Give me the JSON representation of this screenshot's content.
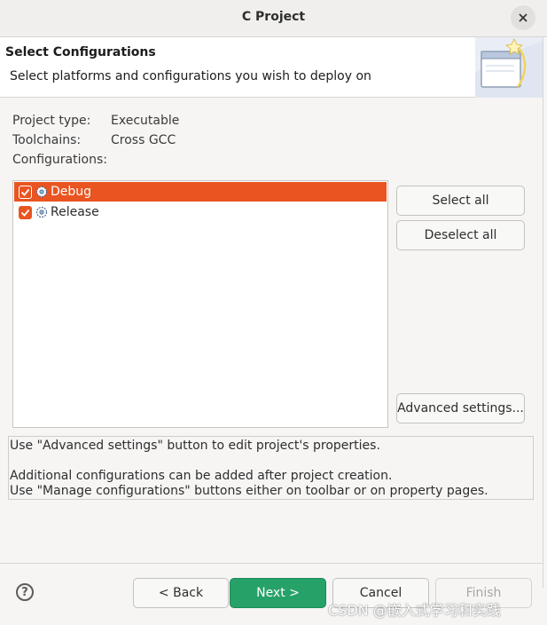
{
  "window": {
    "title": "C Project",
    "close_icon": "close-icon"
  },
  "header": {
    "title": "Select Configurations",
    "subtitle": "Select platforms and configurations you wish to deploy on",
    "image_icon": "wizard-banner-icon"
  },
  "project_info": {
    "type_label": "Project type:",
    "type_value": "Executable",
    "toolchains_label": "Toolchains:",
    "toolchains_value": "Cross GCC",
    "configurations_label": "Configurations:"
  },
  "configurations": [
    {
      "label": "Debug",
      "checked": true,
      "selected": true,
      "icon": "debug-config-icon"
    },
    {
      "label": "Release",
      "checked": true,
      "selected": false,
      "icon": "release-config-icon"
    }
  ],
  "side_buttons": {
    "select_all": "Select all",
    "deselect_all": "Deselect all",
    "advanced": "Advanced settings..."
  },
  "messages": {
    "line1": "Use \"Advanced settings\" button to edit project's properties.",
    "line2": "Additional configurations can be added after project creation.",
    "line3": "Use \"Manage configurations\" buttons either on toolbar or on property pages."
  },
  "footer": {
    "help_icon": "help-icon",
    "help_glyph": "?",
    "back": "< Back",
    "next": "Next >",
    "cancel": "Cancel",
    "finish": "Finish"
  },
  "watermark": "CSDN @嵌入式学习和实践",
  "colors": {
    "accent": "#e95420",
    "primary": "#26a269"
  }
}
